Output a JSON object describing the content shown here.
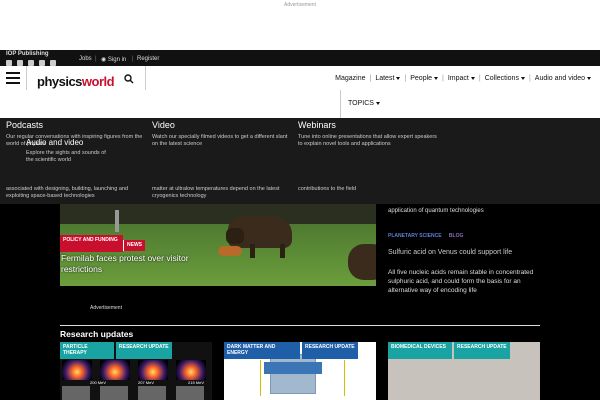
{
  "ad": {
    "label": "Advertisement"
  },
  "topbar": {
    "brand": "IOP Publishing",
    "jobs": "Jobs",
    "sign_in": "Sign in",
    "register": "Register"
  },
  "header": {
    "logo_first": "physics",
    "logo_second": "world",
    "nav": [
      "Magazine",
      "Latest",
      "People",
      "Impact",
      "Collections",
      "Audio and video"
    ],
    "topics": "TOPICS"
  },
  "dropdown": {
    "podcasts": {
      "title": "Podcasts",
      "text": "Our regular conversations with inspiring figures from the world of physics"
    },
    "audio_video": {
      "title": "Audio and video",
      "text": "Explore the sights and sounds of the scientific world"
    },
    "video": {
      "title": "Video",
      "text": "Watch our specially filmed videos to get a different slant on the latest science"
    },
    "webinars": {
      "title": "Webinars",
      "text": "Tune into online presentations that allow expert speakers to explain novel tools and applications"
    },
    "bottom": [
      "associated with designing, building, launching and exploiting space-based technologies",
      "matter at ultralow temperatures depend on the latest cryogenics technology",
      "contributions to the field"
    ]
  },
  "hero": {
    "tag_category": "POLICY AND FUNDING",
    "tag_type": "NEWS",
    "title": "Fermilab faces protest over visitor restrictions"
  },
  "side": {
    "top_text": "application of quantum technologies",
    "tag_planetary": "PLANETARY SCIENCE",
    "tag_blog": "BLOG",
    "headline": "Sulfuric acid on Venus could support life",
    "description": "All five nucleic acids remain stable in concentrated sulphuric acid, and could form the basis for an alternative way of encoding life"
  },
  "advert_label": "Advertisement",
  "research": {
    "section_title": "Research updates",
    "cards": [
      {
        "tag1": "PARTICLE THERAPY",
        "tag2": "RESEARCH UPDATE"
      },
      {
        "tag1": "DARK MATTER AND ENERGY",
        "tag2": "RESEARCH UPDATE"
      },
      {
        "tag1": "BIOMEDICAL DEVICES",
        "tag2": "RESEARCH UPDATE"
      }
    ],
    "mev_labels": [
      "200 MeV",
      "207 MeV",
      "215 MeV"
    ]
  },
  "colors": {
    "accent_red": "#c8102e",
    "teal": "#1aa3a3",
    "blue": "#1f5fa8"
  }
}
